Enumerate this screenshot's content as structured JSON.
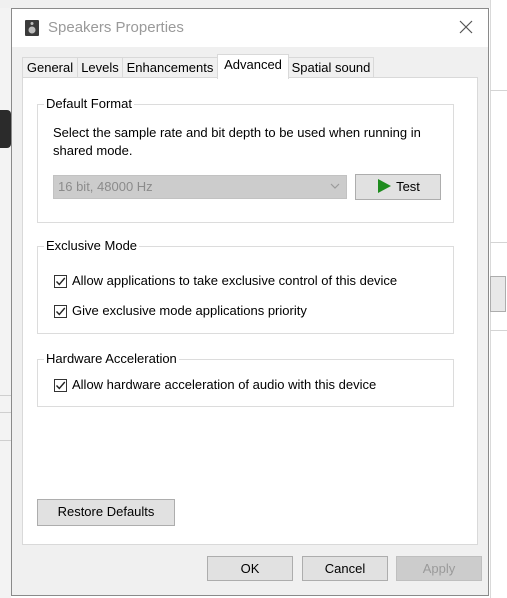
{
  "dialog": {
    "title": "Speakers Properties",
    "tabs": [
      {
        "label": "General"
      },
      {
        "label": "Levels"
      },
      {
        "label": "Enhancements"
      },
      {
        "label": "Advanced"
      },
      {
        "label": "Spatial sound"
      }
    ],
    "active_tab": "Advanced"
  },
  "default_format": {
    "title": "Default Format",
    "description_line1": "Select the sample rate and bit depth to be used when running in",
    "description_line2": "shared mode.",
    "selected_format": "16 bit, 48000 Hz",
    "test_label": "Test"
  },
  "exclusive_mode": {
    "title": "Exclusive Mode",
    "options": [
      {
        "label": "Allow applications to take exclusive control of this device",
        "checked": true
      },
      {
        "label": "Give exclusive mode applications priority",
        "checked": true
      }
    ]
  },
  "hardware_acceleration": {
    "title": "Hardware Acceleration",
    "options": [
      {
        "label": "Allow hardware acceleration of audio with this device",
        "checked": true
      }
    ]
  },
  "buttons": {
    "restore_defaults": "Restore Defaults",
    "ok": "OK",
    "cancel": "Cancel",
    "apply": "Apply"
  },
  "colors": {
    "play_icon": "#1e8c1e",
    "dialog_bg": "#f0f0f0"
  }
}
